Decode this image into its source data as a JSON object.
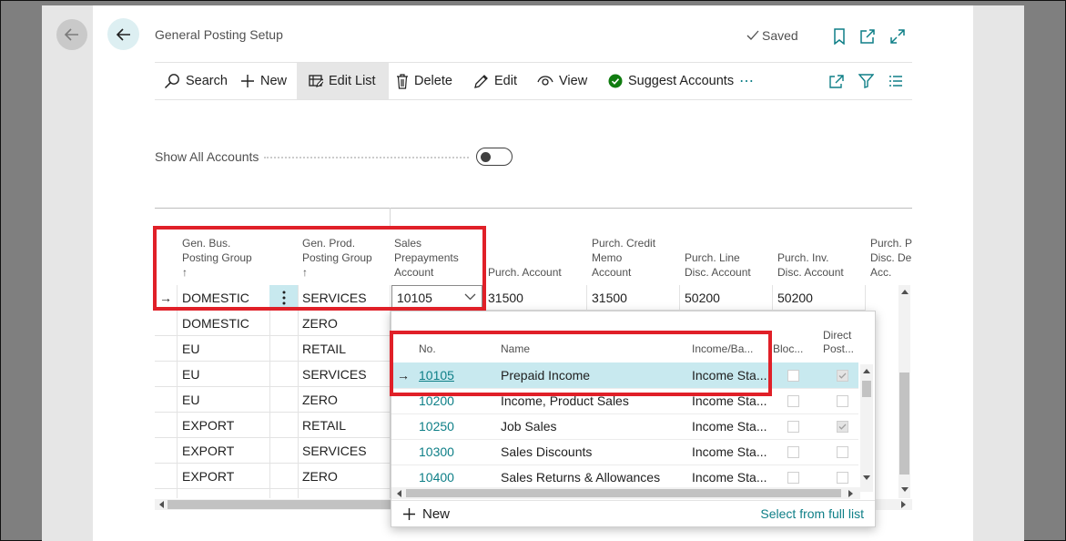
{
  "page": {
    "title": "General Posting Setup",
    "saved_label": "Saved"
  },
  "actions": {
    "search": "Search",
    "new": "New",
    "edit_list": "Edit List",
    "delete": "Delete",
    "edit": "Edit",
    "view": "View",
    "suggest_accounts": "Suggest Accounts",
    "more": "⋯"
  },
  "toggle": {
    "label": "Show All Accounts",
    "state": "off"
  },
  "grid": {
    "columns": {
      "gen_bus_1": "Gen. Bus.",
      "gen_bus_2": "Posting Group",
      "gen_prod_1": "Gen. Prod.",
      "gen_prod_2": "Posting Group",
      "sort_arrow": "↑",
      "sales_prep_1": "Sales",
      "sales_prep_2": "Prepayments",
      "sales_prep_3": "Account",
      "purch_account": "Purch. Account",
      "purch_cm_1": "Purch. Credit",
      "purch_cm_2": "Memo",
      "purch_cm_3": "Account",
      "purch_line_1": "Purch. Line",
      "purch_line_2": "Disc. Account",
      "purch_inv_1": "Purch. Inv.",
      "purch_inv_2": "Disc. Account",
      "purch_pr_1": "Purch. Pr",
      "purch_pr_2": "Disc. Deb",
      "purch_pr_3": "Acc."
    },
    "current_row_arrow": "→",
    "rows": [
      {
        "bus": "DOMESTIC",
        "prod": "SERVICES",
        "sales_prep": "10105",
        "purch_account": "31500",
        "purch_cm": "31500",
        "purch_line": "50200",
        "purch_inv": "50200"
      },
      {
        "bus": "DOMESTIC",
        "prod": "ZERO"
      },
      {
        "bus": "EU",
        "prod": "RETAIL"
      },
      {
        "bus": "EU",
        "prod": "SERVICES"
      },
      {
        "bus": "EU",
        "prod": "ZERO"
      },
      {
        "bus": "EXPORT",
        "prod": "RETAIL"
      },
      {
        "bus": "EXPORT",
        "prod": "SERVICES"
      },
      {
        "bus": "EXPORT",
        "prod": "ZERO"
      }
    ]
  },
  "lookup": {
    "headers": {
      "no": "No.",
      "name": "Name",
      "income_balance": "Income/Ba...",
      "blocked": "Bloc...",
      "direct_1": "Direct",
      "direct_2": "Post..."
    },
    "selected_arrow": "→",
    "rows": [
      {
        "no": "10105",
        "name": "Prepaid Income",
        "income": "Income Sta...",
        "blocked": false,
        "direct": true
      },
      {
        "no": "10200",
        "name": "Income, Product Sales",
        "income": "Income Sta...",
        "blocked": false,
        "direct": false
      },
      {
        "no": "10250",
        "name": "Job Sales",
        "income": "Income Sta...",
        "blocked": false,
        "direct": true
      },
      {
        "no": "10300",
        "name": "Sales Discounts",
        "income": "Income Sta...",
        "blocked": false,
        "direct": false
      },
      {
        "no": "10400",
        "name": "Sales Returns & Allowances",
        "income": "Income Sta...",
        "blocked": false,
        "direct": false
      }
    ],
    "new_label": "New",
    "full_list_label": "Select from full list"
  },
  "colors": {
    "accent": "#0e7f87",
    "selection": "#c8e9ef",
    "highlight_box": "#e02028",
    "success": "#107c10"
  }
}
